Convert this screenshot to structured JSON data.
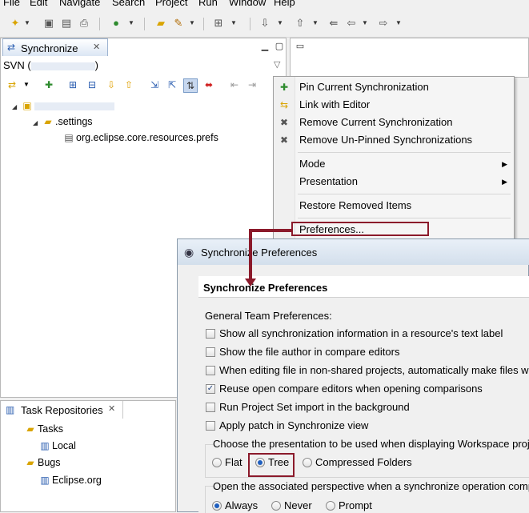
{
  "menubar": [
    "File",
    "Edit",
    "Navigate",
    "Search",
    "Project",
    "Run",
    "Window",
    "Help"
  ],
  "sync_view": {
    "tab_label": "Synchronize",
    "svn_label": "SVN (",
    "svn_label_end": ")",
    "tree": [
      {
        "label": ".settings"
      },
      {
        "label": "org.eclipse.core.resources.prefs"
      }
    ]
  },
  "context_menu": {
    "items": [
      {
        "label": "Pin Current Synchronization",
        "icon": "pin-icon"
      },
      {
        "label": "Link with Editor",
        "icon": "link-icon"
      },
      {
        "label": "Remove Current Synchronization",
        "icon": "remove-icon"
      },
      {
        "label": "Remove Un-Pinned Synchronizations",
        "icon": "remove-all-icon"
      },
      {
        "label": "Mode"
      },
      {
        "label": "Presentation"
      },
      {
        "label": "Restore Removed Items"
      },
      {
        "label": "Preferences..."
      }
    ]
  },
  "task_repositories": {
    "tab_label": "Task Repositories",
    "groups": [
      {
        "label": "Tasks",
        "children": [
          "Local"
        ]
      },
      {
        "label": "Bugs",
        "children": [
          "Eclipse.org"
        ]
      }
    ]
  },
  "dialog": {
    "title": "Synchronize Preferences",
    "header": "Synchronize Preferences",
    "general_label": "General Team Preferences:",
    "options": [
      {
        "label": "Show all synchronization information in a resource's text label",
        "checked": false
      },
      {
        "label": "Show the file author in compare editors",
        "checked": false
      },
      {
        "label": "When editing file in non-shared projects, automatically make files w",
        "checked": false
      },
      {
        "label": "Reuse open compare editors when opening comparisons",
        "checked": true
      },
      {
        "label": "Run Project Set import in the background",
        "checked": false
      },
      {
        "label": "Apply patch in Synchronize view",
        "checked": false
      }
    ],
    "presentation_label": "Choose the presentation to be used when displaying Workspace proj",
    "presentation_options": [
      {
        "label": "Flat",
        "selected": false
      },
      {
        "label": "Tree",
        "selected": true
      },
      {
        "label": "Compressed Folders",
        "selected": false
      }
    ],
    "perspective_label": "Open the associated perspective when a synchronize operation comp",
    "perspective_options": [
      {
        "label": "Always",
        "selected": true
      },
      {
        "label": "Never",
        "selected": false
      },
      {
        "label": "Prompt",
        "selected": false
      }
    ]
  },
  "colors": {
    "highlight": "#8b1a2b",
    "accent": "#1f5fbf"
  }
}
